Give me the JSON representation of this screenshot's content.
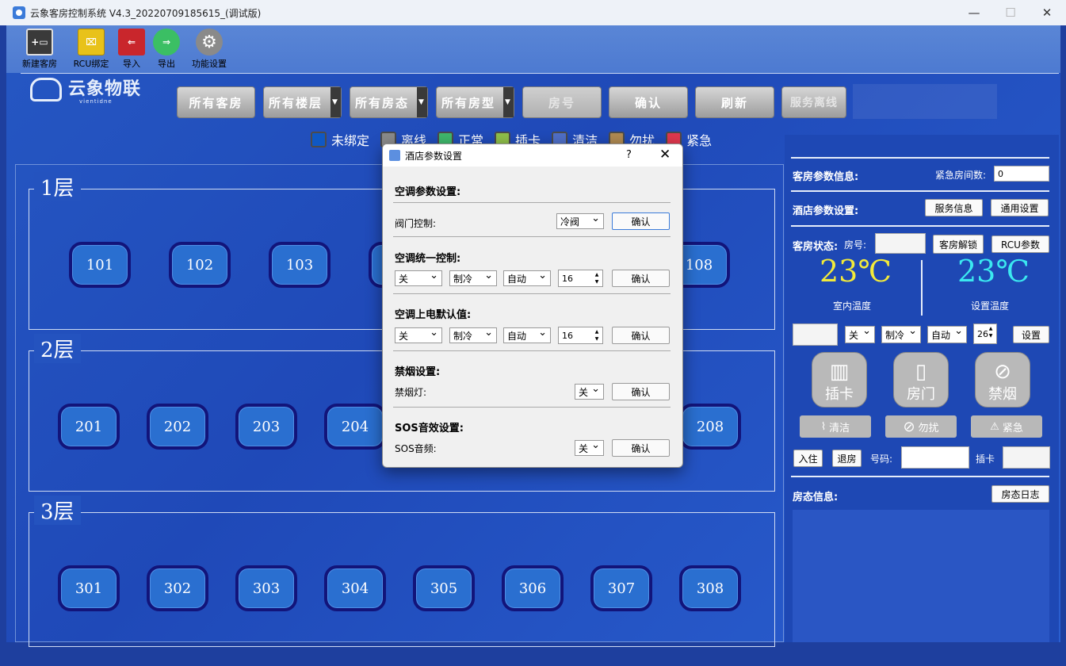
{
  "window": {
    "title": "云象客房控制系统 V4.3_20220709185615_(调试版)",
    "min_glyph": "—",
    "max_glyph": "☐",
    "close_glyph": "✕"
  },
  "toolbar": {
    "items": [
      {
        "label": "新建客房",
        "icon": "new-room-icon",
        "color": "#3a3a3a"
      },
      {
        "label": "RCU绑定",
        "icon": "rcu-bind-icon",
        "color": "#e8c21a"
      },
      {
        "label": "导入",
        "icon": "import-icon",
        "color": "#c9262c"
      },
      {
        "label": "导出",
        "icon": "export-icon",
        "color": "#3bbf64"
      },
      {
        "label": "功能设置",
        "icon": "gear-icon",
        "color": "#8a8a8a"
      }
    ]
  },
  "logo": {
    "text": "云象物联",
    "sub": "vientidne"
  },
  "filters": {
    "all_rooms": "所有客房",
    "all_floors": "所有楼层",
    "all_status": "所有房态",
    "all_types": "所有房型",
    "room_no": "房号",
    "confirm": "确认",
    "refresh": "刷新",
    "service_offline": "服务离线"
  },
  "legend": [
    {
      "label": "未绑定",
      "color": "#0f58c4"
    },
    {
      "label": "离线",
      "color": "#8a8a8a"
    },
    {
      "label": "正常",
      "color": "#3fb86c"
    },
    {
      "label": "插卡",
      "color": "#8fbf4a"
    },
    {
      "label": "清洁",
      "color": "#4f6fc8"
    },
    {
      "label": "勿扰",
      "color": "#b08a52"
    },
    {
      "label": "紧急",
      "color": "#e0384e"
    }
  ],
  "floors": [
    {
      "label": "1层",
      "rooms": [
        "101",
        "102",
        "103",
        "104",
        "",
        "",
        "",
        "108"
      ]
    },
    {
      "label": "2层",
      "rooms": [
        "201",
        "202",
        "203",
        "204",
        "",
        "",
        "",
        "208"
      ]
    },
    {
      "label": "3层",
      "rooms": [
        "301",
        "302",
        "303",
        "304",
        "305",
        "306",
        "307",
        "308"
      ]
    }
  ],
  "right_panel": {
    "room_params_label": "客房参数信息:",
    "emergency_count_label": "紧急房间数:",
    "emergency_count_value": "0",
    "hotel_params_label": "酒店参数设置:",
    "service_info_btn": "服务信息",
    "general_settings_btn": "通用设置",
    "room_status_label": "客房状态:",
    "room_no_label": "房号:",
    "room_unlock_btn": "客房解锁",
    "rcu_params_btn": "RCU参数",
    "indoor_temp": "23℃",
    "indoor_temp_label": "室内温度",
    "set_temp": "23℃",
    "set_temp_label": "设置温度",
    "ac_power": "关",
    "ac_mode": "制冷",
    "ac_fan": "自动",
    "ac_temp": "26",
    "set_btn": "设置",
    "card_label": "插卡",
    "door_label": "房门",
    "nosmoke_label": "禁烟",
    "clean_btn": "清洁",
    "dnd_btn": "勿扰",
    "emergency_btn": "紧急",
    "checkin_btn": "入住",
    "checkout_btn": "退房",
    "card_no_label": "号码:",
    "card_label2": "插卡",
    "room_info_label": "房态信息:",
    "room_log_btn": "房态日志"
  },
  "dialog": {
    "title": "酒店参数设置",
    "help": "?",
    "close": "✕",
    "ac_params": "空调参数设置:",
    "valve_label": "阀门控制:",
    "valve_value": "冷阀",
    "confirm": "确认",
    "ac_unified": "空调统一控制:",
    "u_power": "关",
    "u_mode": "制冷",
    "u_fan": "自动",
    "u_temp": "16",
    "ac_default": "空调上电默认值:",
    "d_power": "关",
    "d_mode": "制冷",
    "d_fan": "自动",
    "d_temp": "16",
    "smoke": "禁烟设置:",
    "smoke_light_label": "禁烟灯:",
    "smoke_light_value": "关",
    "sos": "SOS音效设置:",
    "sos_audio_label": "SOS音频:",
    "sos_audio_value": "关"
  }
}
